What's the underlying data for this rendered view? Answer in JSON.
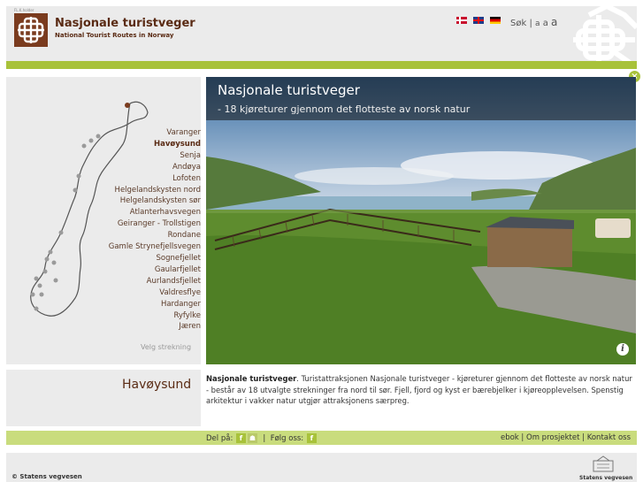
{
  "header": {
    "tiny_label": "FL.K.holder",
    "title": "Nasjonale turistveger",
    "subtitle": "National Tourist Routes in Norway",
    "menu": {
      "search": "Søk",
      "sep": "|",
      "size_small": "a",
      "size_medium": "a",
      "size_large": "a"
    }
  },
  "map": {
    "routes": [
      {
        "label": "Varanger",
        "active": false
      },
      {
        "label": "Havøysund",
        "active": true
      },
      {
        "label": "Senja",
        "active": false
      },
      {
        "label": "Andøya",
        "active": false
      },
      {
        "label": "Lofoten",
        "active": false
      },
      {
        "label": "Helgelandskysten nord",
        "active": false
      },
      {
        "label": "Helgelandskysten sør",
        "active": false
      },
      {
        "label": "Atlanterhavsvegen",
        "active": false
      },
      {
        "label": "Geiranger - Trollstigen",
        "active": false
      },
      {
        "label": "Rondane",
        "active": false
      },
      {
        "label": "Gamle Strynefjellsvegen",
        "active": false
      },
      {
        "label": "Sognefjellet",
        "active": false
      },
      {
        "label": "Gaularfjellet",
        "active": false
      },
      {
        "label": "Aurlandsfjellet",
        "active": false
      },
      {
        "label": "Valdresflye",
        "active": false
      },
      {
        "label": "Hardanger",
        "active": false
      },
      {
        "label": "Ryfylke",
        "active": false
      },
      {
        "label": "Jæren",
        "active": false
      }
    ],
    "select_label": "Velg strekning"
  },
  "hero": {
    "title": "Nasjonale turistveger",
    "subtitle": "- 18 kjøreturer gjennom det flotteste av norsk natur",
    "info": "i"
  },
  "description": {
    "heading": "Havøysund",
    "bold": "Nasjonale turistveger",
    "text": ". Turistattraksjonen Nasjonale turistveger - kjøreturer gjennom det flotteste av norsk natur - består av 18 utvalgte strekninger fra nord til sør. Fjell, fjord og kyst er bærebjelker i kjøreopplevelsen. Spenstig arkitektur i vakker natur utgjør attraksjonens særpreg."
  },
  "footer": {
    "share_label": "Del på:",
    "sep": "|",
    "follow_label": "Følg oss:",
    "links": [
      "ebok",
      "Om prosjektet",
      "Kontakt oss"
    ]
  },
  "bottom": {
    "copyright": "© Statens vegvesen",
    "logo_label": "Statens vegvesen"
  },
  "colors": {
    "brand_brown": "#5a2b14",
    "accent_green": "#a8c23a",
    "panel_grey": "#ebebeb"
  }
}
